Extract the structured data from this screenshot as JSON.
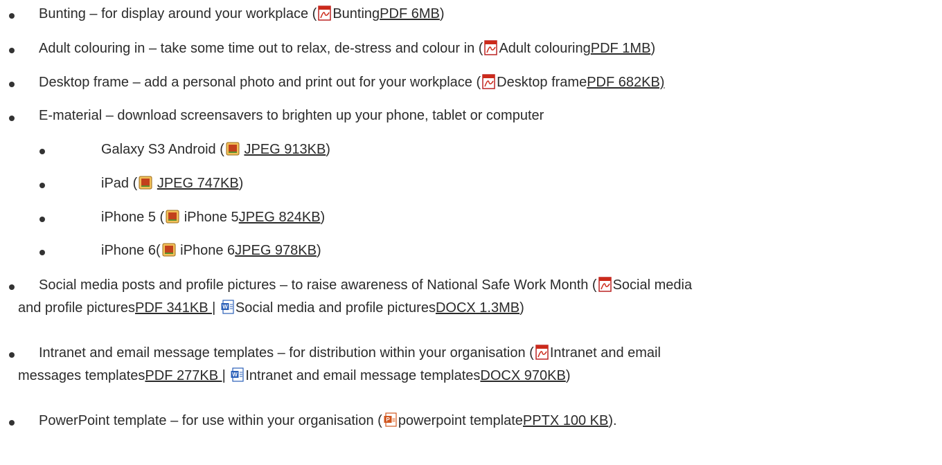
{
  "items": [
    {
      "lead": "Bunting – for display around your workplace (",
      "icon": "pdf-icon",
      "label": "Bunting",
      "link": "PDF 6MB",
      "tail": ")"
    },
    {
      "lead": "Adult colouring in – take some time out to relax, de-stress and colour in (",
      "icon": "pdf-icon",
      "label": "Adult colouring",
      "link": "PDF 1MB",
      "tail": ")"
    },
    {
      "lead": "Desktop frame – add a personal photo and print out for your workplace (",
      "icon": "pdf-icon",
      "label": "Desktop frame",
      "link": "PDF 682KB)",
      "tail": ""
    },
    {
      "lead": "E-material – download screensavers to brighten up your phone, tablet or computer"
    },
    {
      "lead": "Galaxy S3 Android (",
      "icon": "image-icon",
      "label": " ",
      "link": "JPEG 913KB",
      "tail": ")"
    },
    {
      "lead": "iPad (",
      "icon": "image-icon",
      "label": " ",
      "link": "JPEG 747KB",
      "tail": ")"
    },
    {
      "lead": "iPhone 5 (",
      "icon": "image-icon",
      "label": " iPhone 5",
      "link": "JPEG 824KB",
      "tail": ")"
    },
    {
      "lead": "iPhone 6(",
      "icon": "image-icon",
      "label": " iPhone 6",
      "link": "JPEG 978KB",
      "tail": ")"
    },
    {
      "lead": "Social media posts and profile pictures – to raise awareness of National Safe Work Month (",
      "icon": "pdf-icon",
      "label": "Social media",
      "line2_lead": "and profile pictures",
      "link": "PDF 341KB |",
      "icon2": "word-icon",
      "label2": "Social media and profile pictures",
      "link2": "DOCX 1.3MB",
      "tail": ")"
    },
    {
      "lead": "Intranet and email message templates – for distribution within your organisation (",
      "icon": "pdf-icon",
      "label": "Intranet and email",
      "line2_lead": "messages templates",
      "link": "PDF 277KB |",
      "icon2": "word-icon",
      "label2": "Intranet and email message templates",
      "link2": "DOCX 970KB",
      "tail": ")"
    },
    {
      "lead": "PowerPoint template – for use within your organisation (",
      "icon": "powerpoint-icon",
      "label": "powerpoint template",
      "link": "PPTX 100 KB",
      "tail": ")."
    }
  ],
  "colors": {
    "text": "#2b2b2b",
    "pdf": "#cc2a1a",
    "word": "#2a5fb8",
    "ppt": "#d0561f",
    "image": "#e8a23a"
  }
}
